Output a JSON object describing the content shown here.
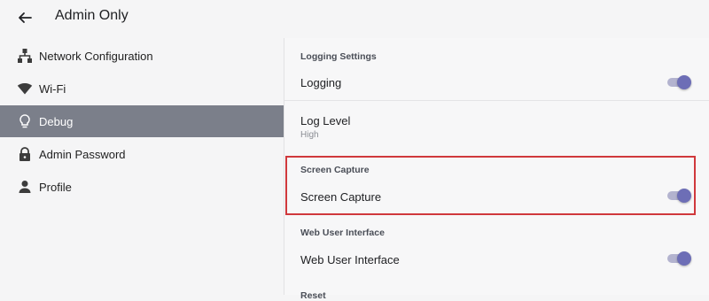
{
  "app": {
    "title": "Admin Only"
  },
  "sidebar": {
    "items": [
      {
        "label": "Network Configuration",
        "icon": "network-icon",
        "active": false
      },
      {
        "label": "Wi-Fi",
        "icon": "wifi-icon",
        "active": false
      },
      {
        "label": "Debug",
        "icon": "lightbulb-icon",
        "active": true
      },
      {
        "label": "Admin Password",
        "icon": "lock-icon",
        "active": false
      },
      {
        "label": "Profile",
        "icon": "person-icon",
        "active": false
      }
    ]
  },
  "main": {
    "sections": [
      {
        "header": "Logging Settings",
        "rows": [
          {
            "label": "Logging",
            "toggle": "on"
          },
          {
            "label": "Log Level",
            "sub": "High"
          }
        ]
      },
      {
        "header": "Screen Capture",
        "rows": [
          {
            "label": "Screen Capture",
            "toggle": "on"
          }
        ]
      },
      {
        "header": "Web User Interface",
        "rows": [
          {
            "label": "Web User Interface",
            "toggle": "on"
          }
        ]
      },
      {
        "header": "Reset"
      }
    ]
  },
  "colors": {
    "active_nav_bg": "#7b7f8a",
    "toggle_thumb": "#6d6eb6",
    "toggle_track": "#b3b3cf",
    "highlight": "#d0383c"
  }
}
